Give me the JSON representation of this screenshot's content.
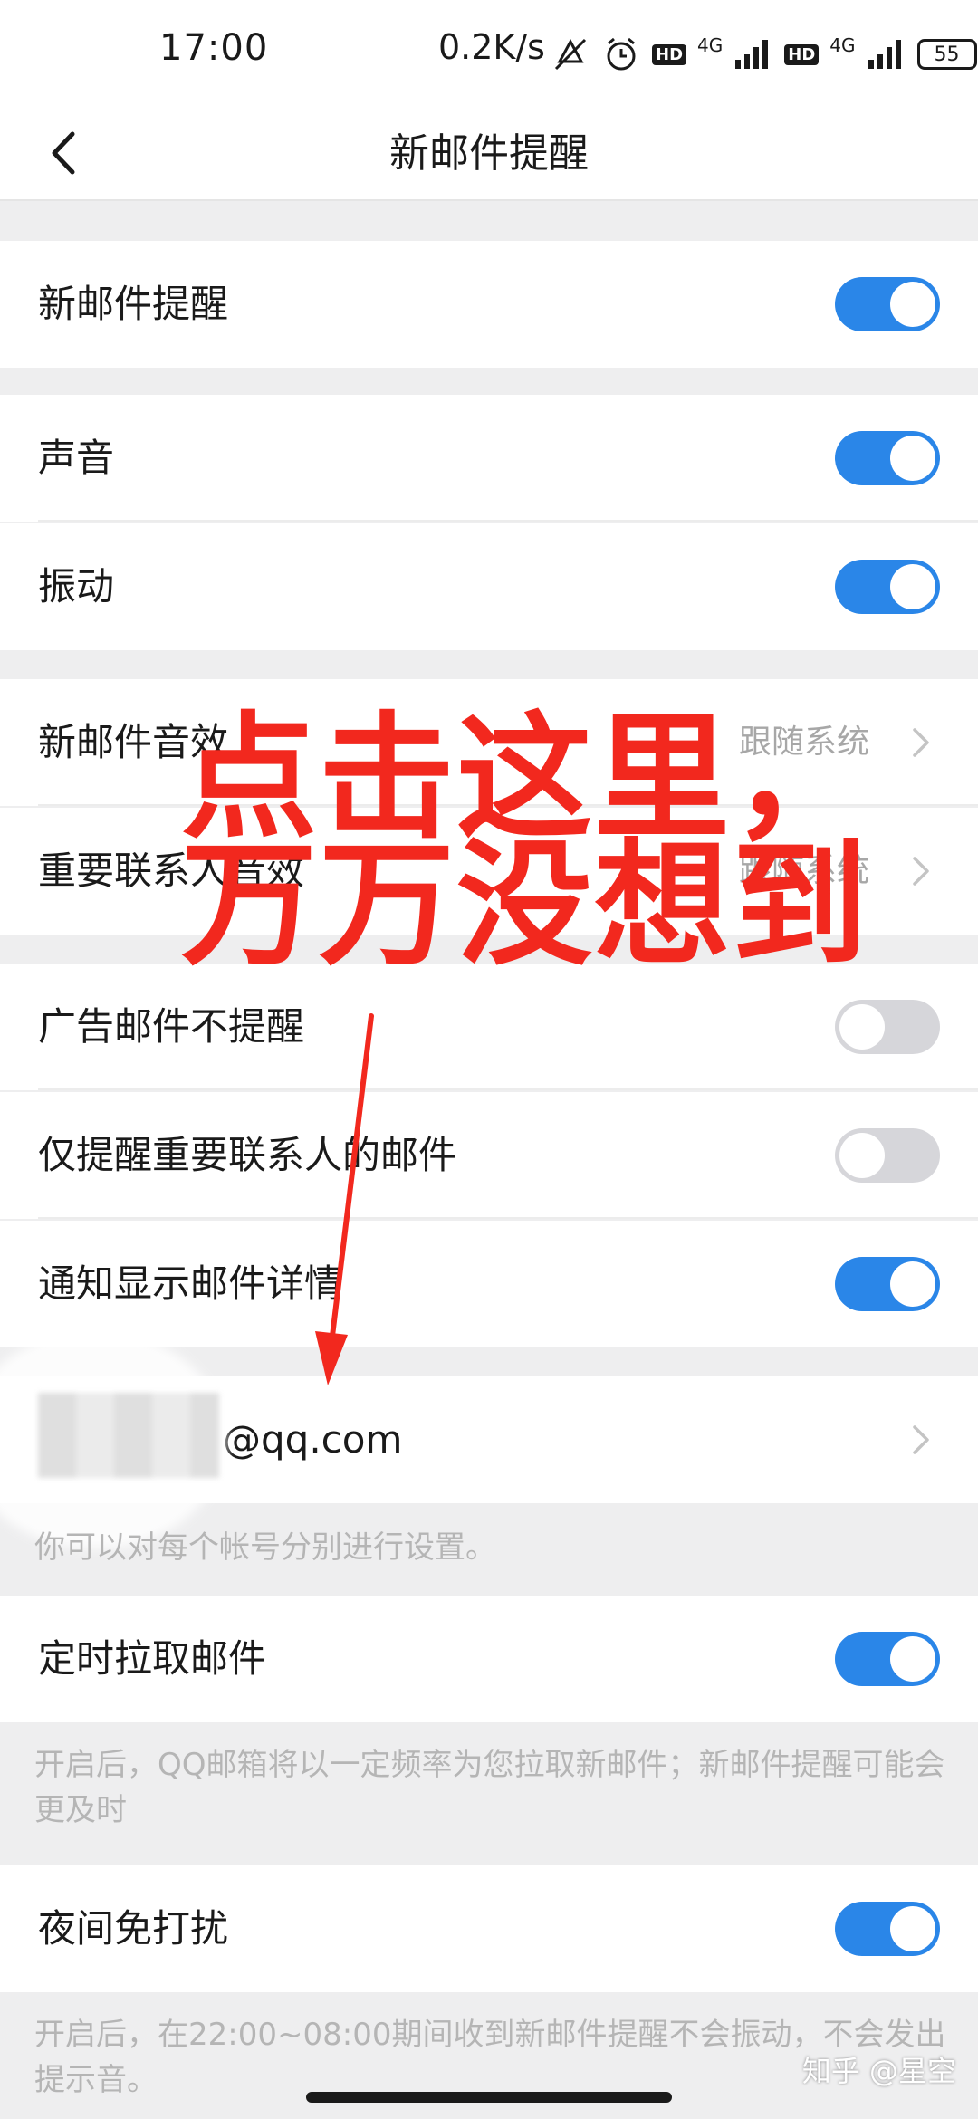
{
  "status_bar": {
    "time": "17:00",
    "net_speed": "0.2K/s",
    "battery": "55",
    "network_1": "4G",
    "network_2": "4G",
    "hd_1": "HD",
    "hd_2": "HD"
  },
  "nav": {
    "title": "新邮件提醒",
    "back_icon": "chevron-left-icon"
  },
  "settings": {
    "new_mail": {
      "label": "新邮件提醒",
      "on": true
    },
    "sound": {
      "label": "声音",
      "on": true
    },
    "vibrate": {
      "label": "振动",
      "on": true
    },
    "mail_sound": {
      "label": "新邮件音效",
      "value": "跟随系统"
    },
    "vip_sound": {
      "label": "重要联系人音效",
      "value": "跟随系统"
    },
    "ad_no_remind": {
      "label": "广告邮件不提醒",
      "on": false
    },
    "only_vip": {
      "label": "仅提醒重要联系人的邮件",
      "on": false
    },
    "show_detail": {
      "label": "通知显示邮件详情",
      "on": true
    },
    "account": {
      "label": "@qq.com"
    },
    "account_hint": "你可以对每个帐号分别进行设置。",
    "scheduled_fetch": {
      "label": "定时拉取邮件",
      "on": true
    },
    "scheduled_hint": "开启后，QQ邮箱将以一定频率为您拉取新邮件；新邮件提醒可能会更及时",
    "night_dnd": {
      "label": "夜间免打扰",
      "on": true
    },
    "night_hint": "开启后，在22:00~08:00期间收到新邮件提醒不会振动，不会发出提示音。"
  },
  "annotation": {
    "text": "点击这里，万万没想到",
    "color": "#f2281e"
  },
  "watermark": "知乎 @星空",
  "colors": {
    "toggle_on": "#2a86e8",
    "toggle_off": "#d6d6da"
  }
}
